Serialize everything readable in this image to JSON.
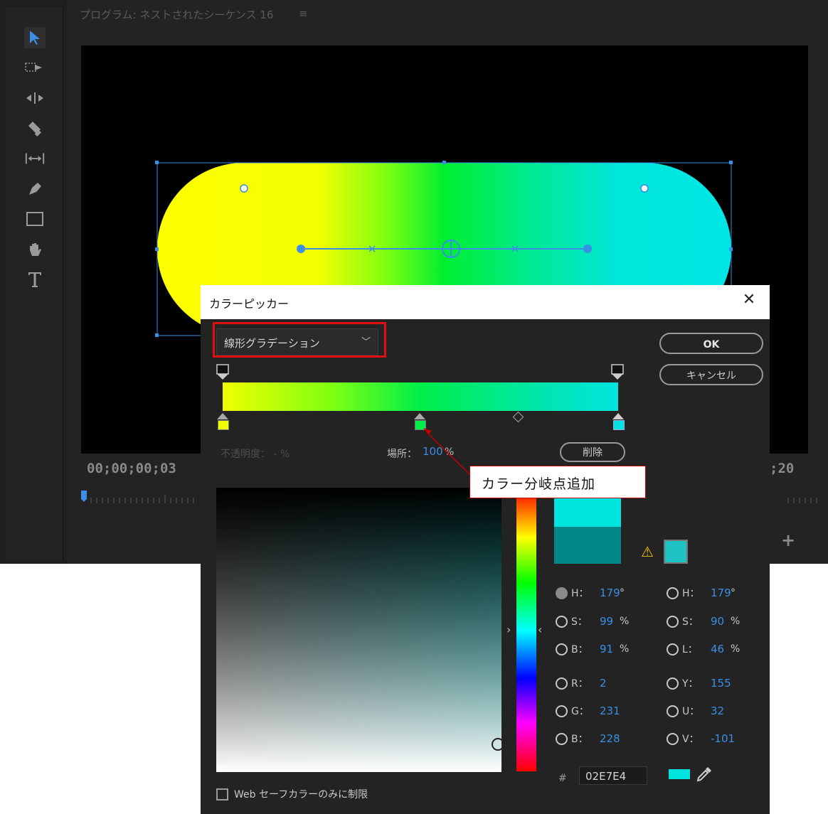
{
  "colors": {
    "accent_blue": "#3a8ee6",
    "warning_yellow": "#f2c200",
    "callout_red": "#c00000",
    "current_swatch": "#00e4e0",
    "previous_swatch": "#008886",
    "stop_left": "#f0ff00",
    "stop_mid": "#00ef4a",
    "stop_right": "#00e4e0"
  },
  "premiere": {
    "program_title": "プログラム: ネストされたシーケンス 16",
    "program_menu_icon": "hamburger-icon",
    "timecode_left": "00;00;00;03",
    "timecode_right": ";20",
    "tools": [
      "selection-icon",
      "track-select-icon",
      "ripple-edit-icon",
      "razor-icon",
      "slip-icon",
      "pen-icon",
      "rectangle-icon",
      "hand-icon",
      "type-icon"
    ]
  },
  "dialog": {
    "title": "カラーピッカー",
    "close_icon": "close-icon",
    "gradient_type": "線形グラデーション",
    "ok_label": "OK",
    "cancel_label": "キャンセル",
    "opacity_label": "不透明度： - %",
    "location_label": "場所：",
    "location_value": "100",
    "location_unit": "%",
    "delete_label": "削除",
    "hsb": {
      "h_label": "H：",
      "h_value": "179",
      "h_unit": "°",
      "s_label": "S：",
      "s_value": "99",
      "s_unit": "%",
      "b_label": "B：",
      "b_value": "91",
      "b_unit": "%"
    },
    "hsl": {
      "h_label": "H：",
      "h_value": "179",
      "h_unit": "°",
      "s_label": "S：",
      "s_value": "90",
      "s_unit": "%",
      "l_label": "L：",
      "l_value": "46",
      "l_unit": "%"
    },
    "rgb": {
      "r_label": "R：",
      "r_value": "2",
      "g_label": "G：",
      "g_value": "231",
      "b_label": "B：",
      "b_value": "228"
    },
    "yuv": {
      "y_label": "Y：",
      "y_value": "155",
      "u_label": "U：",
      "u_value": "32",
      "v_label": "V：",
      "v_value": "-101"
    },
    "hash": "#",
    "hex_value": "02E7E4",
    "websafe_label": "Web セーフカラーのみに制限"
  },
  "callout": {
    "text": "カラー分岐点追加"
  }
}
